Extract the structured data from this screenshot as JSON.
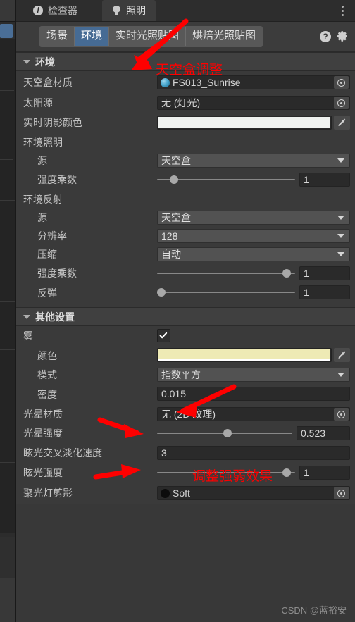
{
  "window": {
    "tabs": [
      {
        "label": "检查器",
        "icon": "info-icon",
        "active": false
      },
      {
        "label": "照明",
        "icon": "lightbulb-icon",
        "active": true
      }
    ],
    "menu_icon": "kebab-menu-icon"
  },
  "toolbar": {
    "segments": [
      {
        "label": "场景",
        "selected": false
      },
      {
        "label": "环境",
        "selected": true
      },
      {
        "label": "实时光照贴图",
        "selected": false
      },
      {
        "label": "烘焙光照贴图",
        "selected": false
      }
    ],
    "help_icon": "help-icon",
    "help_label": "?",
    "settings_icon": "gear-icon",
    "selected_color": "#466b94"
  },
  "environment": {
    "header": "环境",
    "skybox_material": {
      "label": "天空盒材质",
      "value": "FS013_Sunrise",
      "icon": "material-sphere-icon",
      "picker_icon": "object-picker-icon"
    },
    "sun_source": {
      "label": "太阳源",
      "value": "无 (灯光)",
      "picker_icon": "object-picker-icon"
    },
    "realtime_shadow_color": {
      "label": "实时阴影颜色",
      "color": "#f0f2f0",
      "eyedropper_icon": "eyedropper-icon"
    },
    "env_lighting": {
      "group_label": "环境照明",
      "source": {
        "label": "源",
        "value": "天空盒"
      },
      "intensity_multiplier": {
        "label": "强度乘数",
        "value": "1",
        "slider_percent": 12
      }
    },
    "env_reflections": {
      "group_label": "环境反射",
      "source": {
        "label": "源",
        "value": "天空盒"
      },
      "resolution": {
        "label": "分辨率",
        "value": "128"
      },
      "compression": {
        "label": "压缩",
        "value": "自动"
      },
      "intensity_multiplier": {
        "label": "强度乘数",
        "value": "1",
        "slider_percent": 94
      },
      "bounces": {
        "label": "反弹",
        "value": "1",
        "slider_percent": 3
      }
    }
  },
  "other_settings": {
    "header": "其他设置",
    "fog": {
      "label": "雾",
      "checked": true,
      "check_icon": "checkmark-icon"
    },
    "fog_color": {
      "label": "颜色",
      "color": "#eeeab5",
      "eyedropper_icon": "eyedropper-icon"
    },
    "fog_mode": {
      "label": "模式",
      "value": "指数平方"
    },
    "fog_density": {
      "label": "密度",
      "value": "0.015"
    },
    "halo_texture": {
      "label": "光晕材质",
      "value": "无 (2D 纹理)",
      "picker_icon": "object-picker-icon"
    },
    "halo_strength": {
      "label": "光晕强度",
      "value": "0.523",
      "slider_percent": 52
    },
    "flare_fade_speed": {
      "label": "眩光交叉淡化速度",
      "value": "3"
    },
    "flare_strength": {
      "label": "眩光强度",
      "value": "1",
      "slider_percent": 94
    },
    "spot_cookie": {
      "label": "聚光灯剪影",
      "value": "Soft",
      "icon": "texture-thumbnail-icon",
      "picker_icon": "object-picker-icon"
    }
  },
  "annotations": {
    "skybox_note": "天空盒调整",
    "density_note": "调整强弱效果",
    "color": "#fe0000"
  },
  "watermark": "CSDN @蓝裕安"
}
